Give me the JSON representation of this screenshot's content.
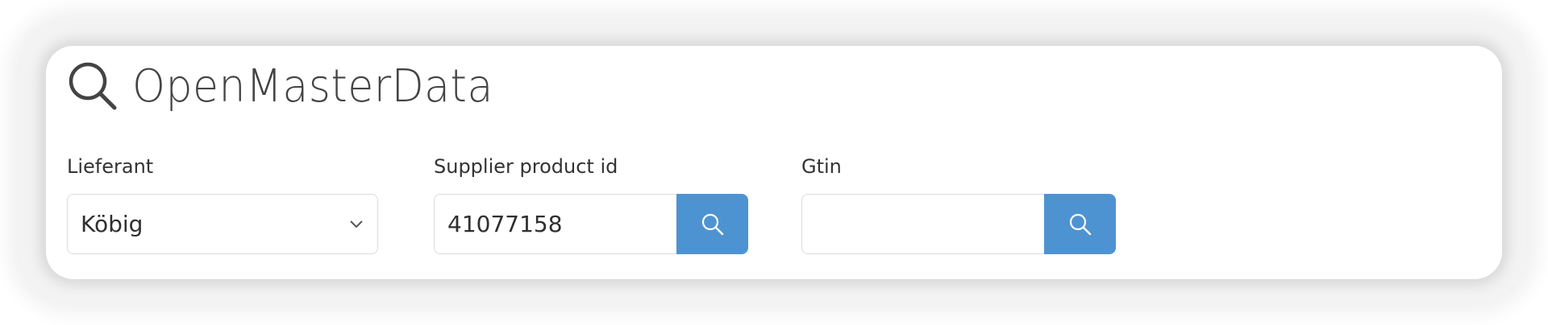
{
  "header": {
    "title": "OpenMasterData",
    "icon": "search-icon"
  },
  "fields": {
    "supplier": {
      "label": "Lieferant",
      "value": "Köbig"
    },
    "supplier_product_id": {
      "label": "Supplier product id",
      "value": "41077158"
    },
    "gtin": {
      "label": "Gtin",
      "value": ""
    }
  },
  "colors": {
    "accent": "#4e93d1",
    "title_text": "#444444",
    "field_border": "#dcdcdc"
  }
}
